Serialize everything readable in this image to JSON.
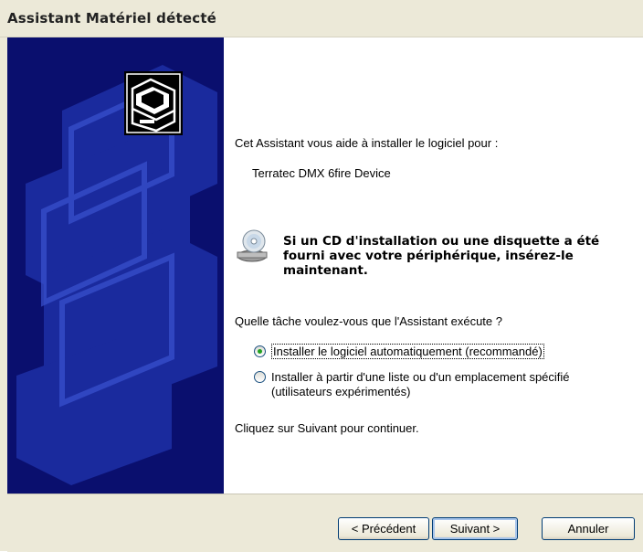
{
  "window": {
    "title": "Assistant Matériel détecté"
  },
  "content": {
    "intro": "Cet Assistant vous aide à installer le logiciel pour :",
    "device_name": "Terratec DMX 6fire Device",
    "cd_message": "Si un CD d'installation ou une disquette a été fourni avec votre périphérique, insérez-le maintenant.",
    "question": "Quelle tâche voulez-vous que l'Assistant exécute ?",
    "options": [
      {
        "label": "Installer le logiciel automatiquement (recommandé)",
        "selected": true
      },
      {
        "label": "Installer à partir d'une liste ou d'un emplacement spécifié (utilisateurs expérimentés)",
        "selected": false
      }
    ],
    "continue_hint": "Cliquez sur Suivant pour continuer."
  },
  "buttons": {
    "back": "< Précédent",
    "next": "Suivant >",
    "cancel": "Annuler"
  },
  "colors": {
    "banner": "#0a0f6e",
    "accent": "#003c74",
    "radio_selected": "#21a121"
  },
  "icons": {
    "hardware": "hardware-card-icon",
    "cd": "cd-drive-icon"
  }
}
